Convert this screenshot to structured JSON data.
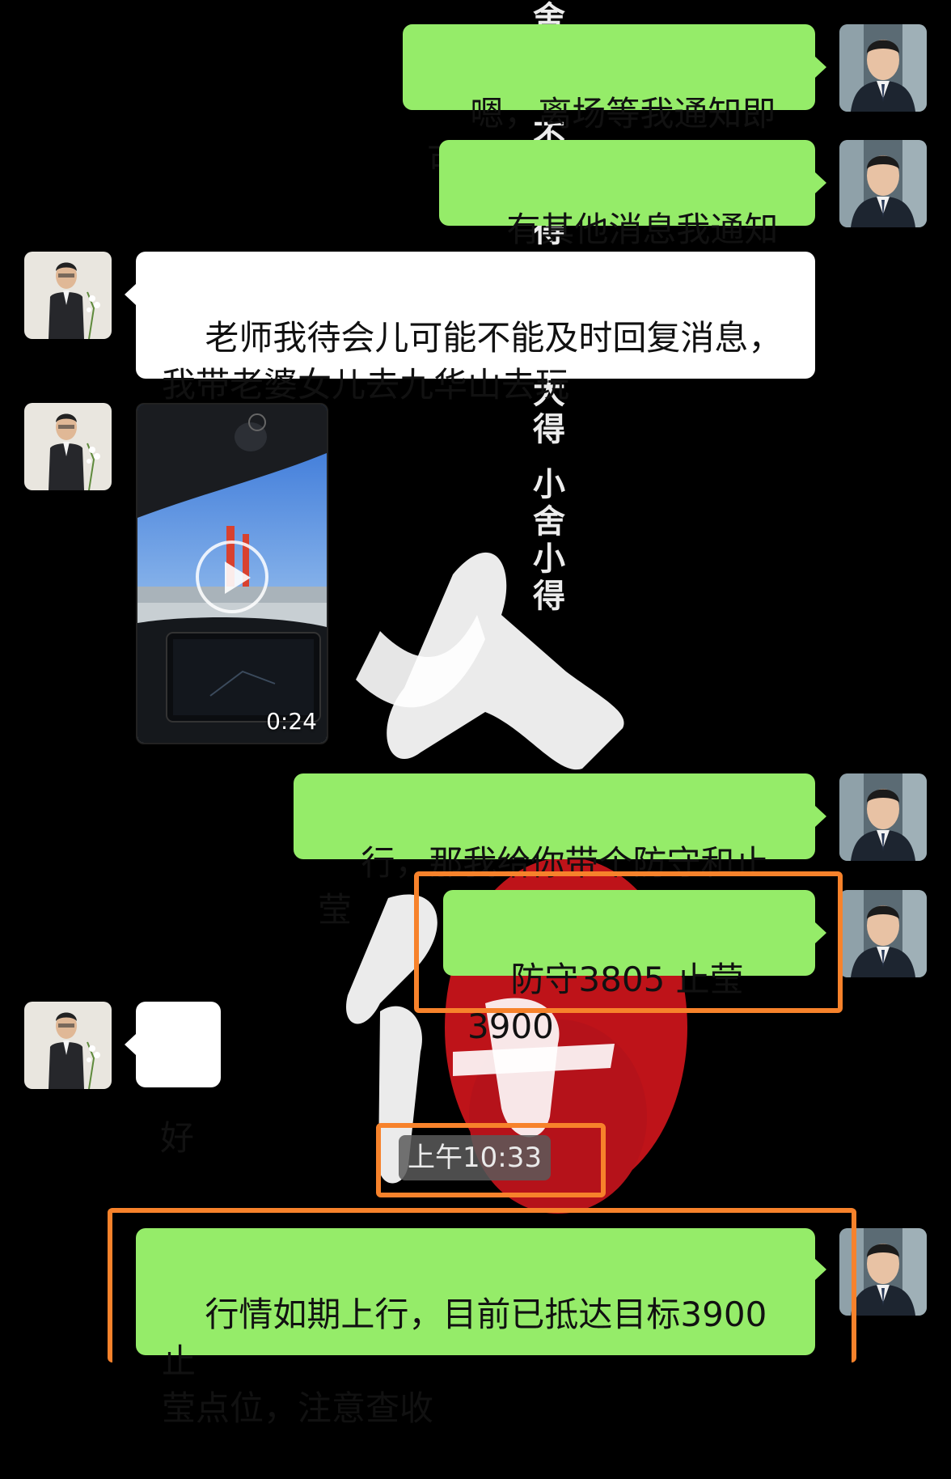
{
  "background": {
    "vertical_text_top": [
      "舍",
      "不",
      "得"
    ],
    "vertical_text_mid": [
      "大",
      "得",
      "小",
      "舍",
      "小",
      "得"
    ],
    "calligraphy": [
      "舍",
      "得"
    ],
    "accent_color": "#d41a1a"
  },
  "colors": {
    "outgoing_bubble": "#95ec69",
    "incoming_bubble": "#ffffff",
    "highlight_box": "#f7822b"
  },
  "messages": [
    {
      "sender": "me",
      "type": "text",
      "text": "嗯，离场等我通知即可"
    },
    {
      "sender": "me",
      "type": "text",
      "text": "有其他消息我通知你"
    },
    {
      "sender": "other",
      "type": "text",
      "text": "老师我待会儿可能不能及时回复消息，\n我带老婆女儿去九华山去玩"
    },
    {
      "sender": "other",
      "type": "video",
      "duration": "0:24"
    },
    {
      "sender": "me",
      "type": "text",
      "text": "行，那我给你带个防守和止莹"
    },
    {
      "sender": "me",
      "type": "text",
      "text": "防守3805 止莹3900",
      "highlighted": true
    },
    {
      "sender": "other",
      "type": "text",
      "text": "好"
    },
    {
      "sender": "system",
      "type": "timestamp",
      "text": "上午10:33",
      "highlighted": true
    },
    {
      "sender": "me",
      "type": "text",
      "text": "行情如期上行，目前已抵达目标3900止\n莹点位，注意查收",
      "highlighted": true
    }
  ],
  "icons": {
    "my_avatar": "businessman-avatar-icon",
    "other_avatar": "man-with-flowers-avatar-icon",
    "play": "play-icon"
  }
}
